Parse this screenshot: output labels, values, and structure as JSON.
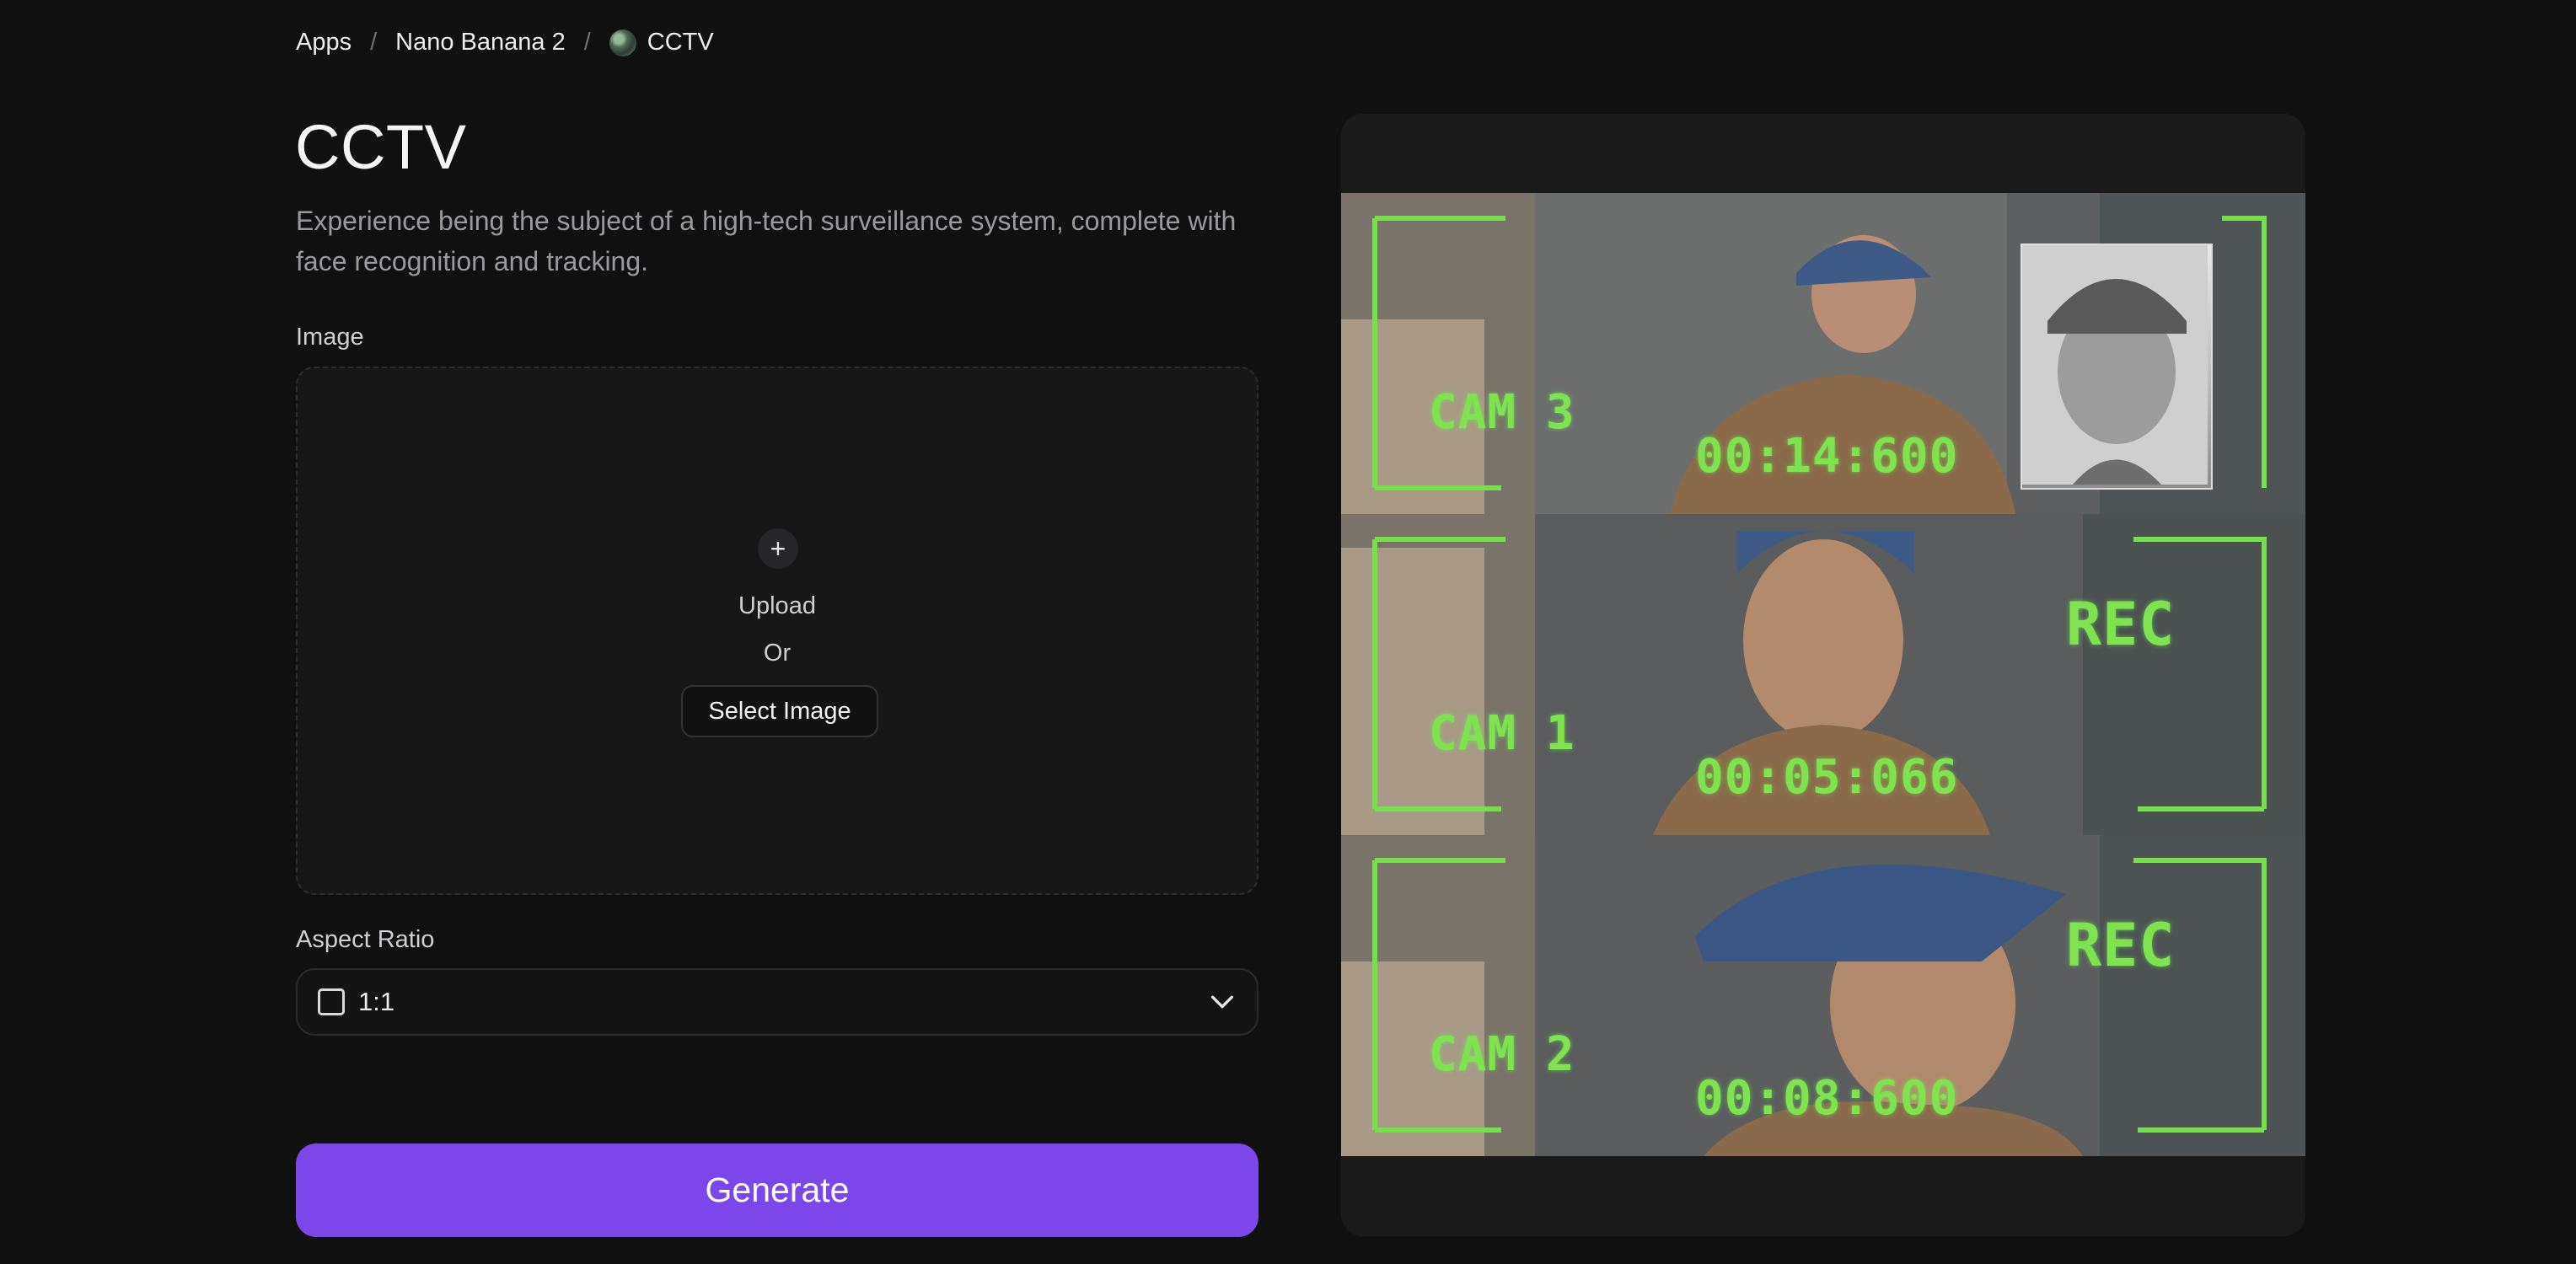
{
  "breadcrumb": {
    "items": [
      "Apps",
      "Nano Banana 2",
      "CCTV"
    ],
    "separator": "/"
  },
  "page": {
    "title": "CCTV",
    "description": "Experience being the subject of a high-tech surveillance system, complete with face recognition and tracking."
  },
  "image_field": {
    "label": "Image",
    "upload_text": "Upload",
    "or_text": "Or",
    "select_button": "Select Image"
  },
  "aspect_ratio": {
    "label": "Aspect Ratio",
    "value": "1:1"
  },
  "generate_button": "Generate",
  "preview": {
    "panels": [
      {
        "cam": "CAM 3",
        "time": "00:14:600",
        "rec": "",
        "has_inset": true
      },
      {
        "cam": "CAM 1",
        "time": "00:05:066",
        "rec": "REC",
        "has_inset": false
      },
      {
        "cam": "CAM 2",
        "time": "00:08:600",
        "rec": "REC",
        "has_inset": false
      }
    ],
    "overlay_color": "#7fe34f"
  },
  "colors": {
    "accent": "#7b47ea",
    "background": "#101011"
  }
}
